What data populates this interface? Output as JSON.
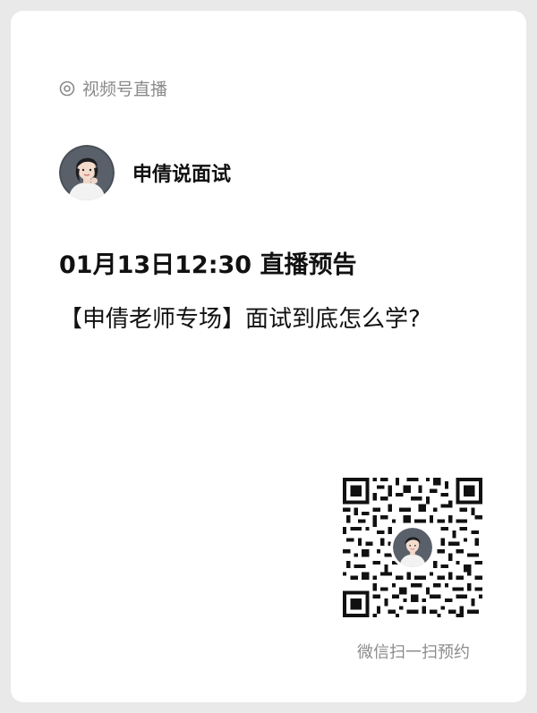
{
  "channel": {
    "label": "视频号直播",
    "icon": "live-circle-icon"
  },
  "host": {
    "name": "申倩说面试",
    "avatar_icon": "host-avatar"
  },
  "live": {
    "time_title": "01月13日12:30 直播预告",
    "topic": "【申倩老师专场】面试到底怎么学?"
  },
  "qr": {
    "caption": "微信扫一扫预约",
    "icon": "qr-code-icon"
  },
  "colors": {
    "card_bg": "#ffffff",
    "page_bg": "#e9e9e9",
    "muted_text": "#8a8a8a",
    "primary_text": "#111111"
  }
}
